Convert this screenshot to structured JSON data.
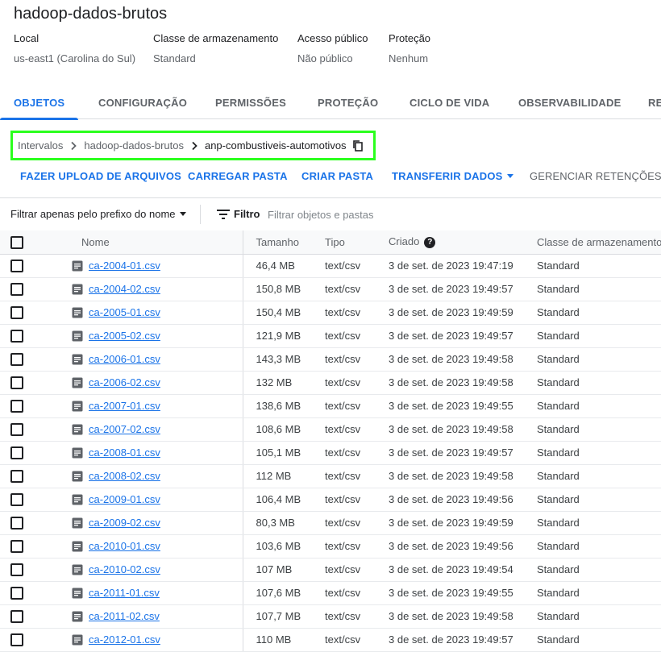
{
  "bucket": {
    "title": "hadoop-dados-brutos",
    "meta": [
      {
        "label": "Local",
        "value": "us-east1 (Carolina do Sul)"
      },
      {
        "label": "Classe de armazenamento",
        "value": "Standard"
      },
      {
        "label": "Acesso público",
        "value": "Não público"
      },
      {
        "label": "Proteção",
        "value": "Nenhum"
      }
    ]
  },
  "tabs": [
    "OBJETOS",
    "CONFIGURAÇÃO",
    "PERMISSÕES",
    "PROTEÇÃO",
    "CICLO DE VIDA",
    "OBSERVABILIDADE",
    "RE"
  ],
  "breadcrumb": {
    "items": [
      "Intervalos",
      "hadoop-dados-brutos"
    ],
    "current": "anp-combustiveis-automotivos"
  },
  "actions": {
    "upload_files": "FAZER UPLOAD DE ARQUIVOS",
    "upload_folder": "CARREGAR PASTA",
    "create_folder": "CRIAR PASTA",
    "transfer_data": "TRANSFERIR DADOS",
    "manage_retention": "GERENCIAR RETENÇÕES"
  },
  "filter": {
    "prefix_label": "Filtrar apenas pelo prefixo do nome",
    "filter_label": "Filtro",
    "placeholder": "Filtrar objetos e pastas"
  },
  "table": {
    "headers": {
      "name": "Nome",
      "size": "Tamanho",
      "type": "Tipo",
      "created": "Criado",
      "storage_class": "Classe de armazenamento"
    },
    "rows": [
      {
        "name": "ca-2004-01.csv",
        "size": "46,4 MB",
        "type": "text/csv",
        "created": "3 de set. de 2023 19:47:19",
        "class": "Standard"
      },
      {
        "name": "ca-2004-02.csv",
        "size": "150,8 MB",
        "type": "text/csv",
        "created": "3 de set. de 2023 19:49:57",
        "class": "Standard"
      },
      {
        "name": "ca-2005-01.csv",
        "size": "150,4 MB",
        "type": "text/csv",
        "created": "3 de set. de 2023 19:49:59",
        "class": "Standard"
      },
      {
        "name": "ca-2005-02.csv",
        "size": "121,9 MB",
        "type": "text/csv",
        "created": "3 de set. de 2023 19:49:57",
        "class": "Standard"
      },
      {
        "name": "ca-2006-01.csv",
        "size": "143,3 MB",
        "type": "text/csv",
        "created": "3 de set. de 2023 19:49:58",
        "class": "Standard"
      },
      {
        "name": "ca-2006-02.csv",
        "size": "132 MB",
        "type": "text/csv",
        "created": "3 de set. de 2023 19:49:58",
        "class": "Standard"
      },
      {
        "name": "ca-2007-01.csv",
        "size": "138,6 MB",
        "type": "text/csv",
        "created": "3 de set. de 2023 19:49:55",
        "class": "Standard"
      },
      {
        "name": "ca-2007-02.csv",
        "size": "108,6 MB",
        "type": "text/csv",
        "created": "3 de set. de 2023 19:49:58",
        "class": "Standard"
      },
      {
        "name": "ca-2008-01.csv",
        "size": "105,1 MB",
        "type": "text/csv",
        "created": "3 de set. de 2023 19:49:57",
        "class": "Standard"
      },
      {
        "name": "ca-2008-02.csv",
        "size": "112 MB",
        "type": "text/csv",
        "created": "3 de set. de 2023 19:49:58",
        "class": "Standard"
      },
      {
        "name": "ca-2009-01.csv",
        "size": "106,4 MB",
        "type": "text/csv",
        "created": "3 de set. de 2023 19:49:56",
        "class": "Standard"
      },
      {
        "name": "ca-2009-02.csv",
        "size": "80,3 MB",
        "type": "text/csv",
        "created": "3 de set. de 2023 19:49:59",
        "class": "Standard"
      },
      {
        "name": "ca-2010-01.csv",
        "size": "103,6 MB",
        "type": "text/csv",
        "created": "3 de set. de 2023 19:49:56",
        "class": "Standard"
      },
      {
        "name": "ca-2010-02.csv",
        "size": "107 MB",
        "type": "text/csv",
        "created": "3 de set. de 2023 19:49:54",
        "class": "Standard"
      },
      {
        "name": "ca-2011-01.csv",
        "size": "107,6 MB",
        "type": "text/csv",
        "created": "3 de set. de 2023 19:49:55",
        "class": "Standard"
      },
      {
        "name": "ca-2011-02.csv",
        "size": "107,7 MB",
        "type": "text/csv",
        "created": "3 de set. de 2023 19:49:58",
        "class": "Standard"
      },
      {
        "name": "ca-2012-01.csv",
        "size": "110 MB",
        "type": "text/csv",
        "created": "3 de set. de 2023 19:49:57",
        "class": "Standard"
      }
    ]
  }
}
